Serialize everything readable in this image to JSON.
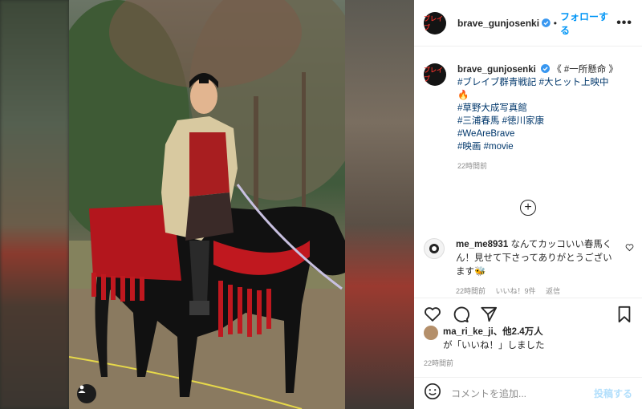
{
  "header": {
    "avatar_text": "ブレイブ",
    "username": "brave_gunjosenki",
    "separator": "•",
    "follow_label": "フォローする",
    "more_label": "•••"
  },
  "caption": {
    "avatar_text": "ブレイブ",
    "username": "brave_gunjosenki",
    "intro": "《 #一所懸命 》",
    "tags": [
      "#ブレイブ群青戦記 #大ヒット上映中",
      "🔥",
      "#草野大成写真館",
      "#三浦春馬 #徳川家康",
      "#WeAreBrave",
      "#映画 #movie"
    ],
    "time": "22時間前"
  },
  "load_more_icon": "plus-circle-icon",
  "comment": {
    "username": "me_me8931",
    "text": "なんてカッコいい春馬くん！見せて下さってありがとうございます🐝",
    "time": "22時間前",
    "likes": "いいね！9件",
    "reply": "返信"
  },
  "actions": {
    "icons": [
      "heart-icon",
      "comment-icon",
      "share-icon",
      "bookmark-icon"
    ]
  },
  "likes": {
    "username": "ma_ri_ke_ji",
    "others": "、他2.4万人",
    "suffix": "が「いいね！」しました"
  },
  "post_time": "22時間前",
  "composer": {
    "placeholder": "コメントを追加...",
    "post_label": "投稿する",
    "emoji_icon": "smiley-icon"
  },
  "colors": {
    "accent_blue": "#0095f6",
    "disabled_blue": "#b2dffc",
    "hashtag": "#00376b",
    "muted": "#8e8e8e",
    "text": "#262626"
  }
}
